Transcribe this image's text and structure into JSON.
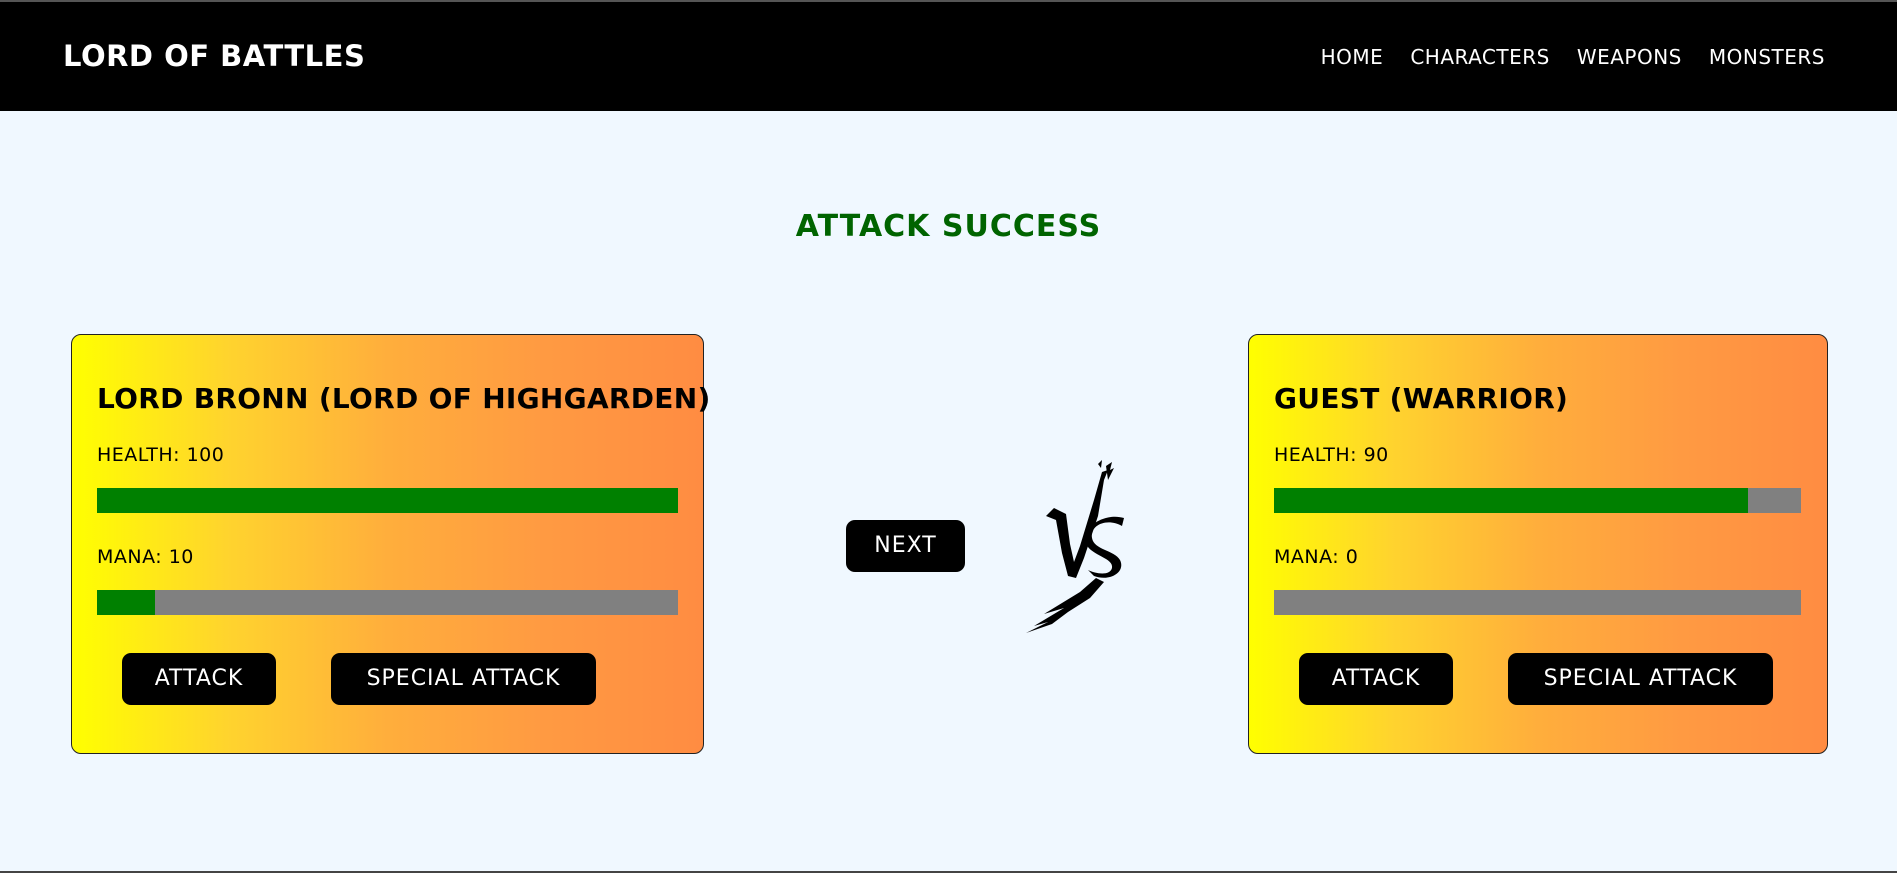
{
  "navbar": {
    "brand": "LORD OF BATTLES",
    "links": [
      "HOME",
      "CHARACTERS",
      "WEAPONS",
      "MONSTERS"
    ]
  },
  "status": {
    "message": "ATTACK SUCCESS",
    "color": "#006400"
  },
  "player": {
    "name": "LORD BRONN (LORD OF HIGHGARDEN)",
    "health_label": "HEALTH: 100",
    "health": 100,
    "health_max": 100,
    "mana_label": "MANA: 10",
    "mana": 10,
    "mana_max": 100,
    "attack_label": "ATTACK",
    "special_label": "SPECIAL ATTACK"
  },
  "opponent": {
    "name": "GUEST (WARRIOR)",
    "health_label": "HEALTH: 90",
    "health": 90,
    "health_max": 100,
    "mana_label": "MANA: 0",
    "mana": 0,
    "mana_max": 100,
    "attack_label": "ATTACK",
    "special_label": "SPECIAL ATTACK"
  },
  "controls": {
    "next_label": "NEXT",
    "vs_icon": "vs-icon"
  },
  "colors": {
    "bar_fill": "#008000",
    "bar_track": "#808080",
    "card_gradient_start": "#ffff00",
    "card_gradient_end": "#ff8c42"
  }
}
